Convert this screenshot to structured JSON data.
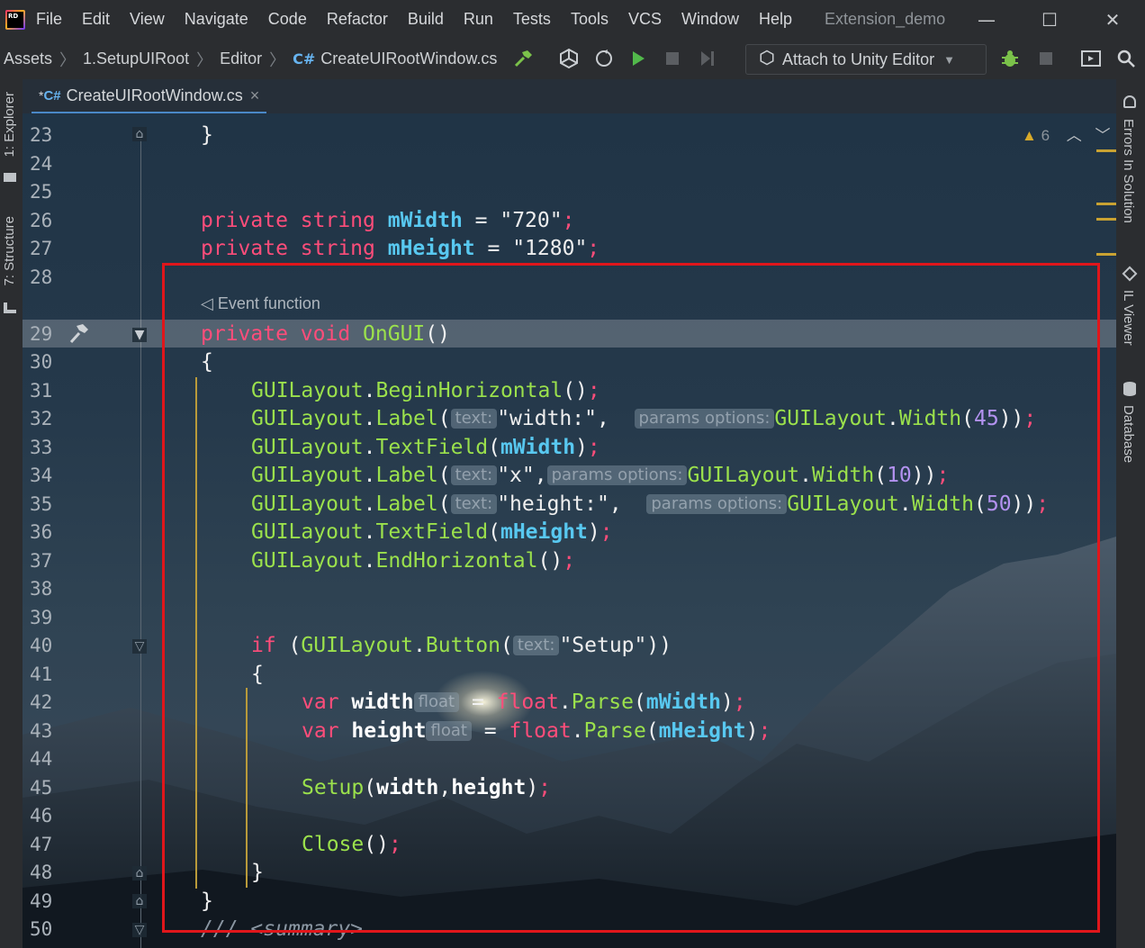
{
  "app": {
    "logo_text": "RD",
    "menu": [
      "File",
      "Edit",
      "View",
      "Navigate",
      "Code",
      "Refactor",
      "Build",
      "Run",
      "Tests",
      "Tools",
      "VCS",
      "Window",
      "Help"
    ],
    "window_title": "Extension_demo"
  },
  "breadcrumb": {
    "items": [
      "Assets",
      "1.SetupUIRoot",
      "Editor"
    ],
    "file_badge": "C#",
    "file": "CreateUIRootWindow.cs"
  },
  "toolbar": {
    "attach_label": "Attach to Unity Editor"
  },
  "side_tabs": {
    "left": [
      "1: Explorer",
      "7: Structure"
    ],
    "right": [
      "Errors In Solution",
      "IL Viewer",
      "Database"
    ]
  },
  "editor_tab": {
    "modified_mark": "*",
    "badge": "C#",
    "label": "CreateUIRootWindow.cs",
    "close": "×"
  },
  "editor": {
    "warning_count": "6",
    "event_hint": "Event function",
    "line_numbers": [
      "23",
      "24",
      "25",
      "26",
      "27",
      "28",
      "29",
      "30",
      "31",
      "32",
      "33",
      "34",
      "35",
      "36",
      "37",
      "38",
      "39",
      "40",
      "41",
      "42",
      "43",
      "44",
      "45",
      "46",
      "47",
      "48",
      "49",
      "50"
    ]
  },
  "colors": {
    "keyword": "#ff4d7a",
    "type": "#9be14c",
    "field": "#58c8f0",
    "highlight_box": "#e0161b",
    "warning": "#c9a232"
  }
}
